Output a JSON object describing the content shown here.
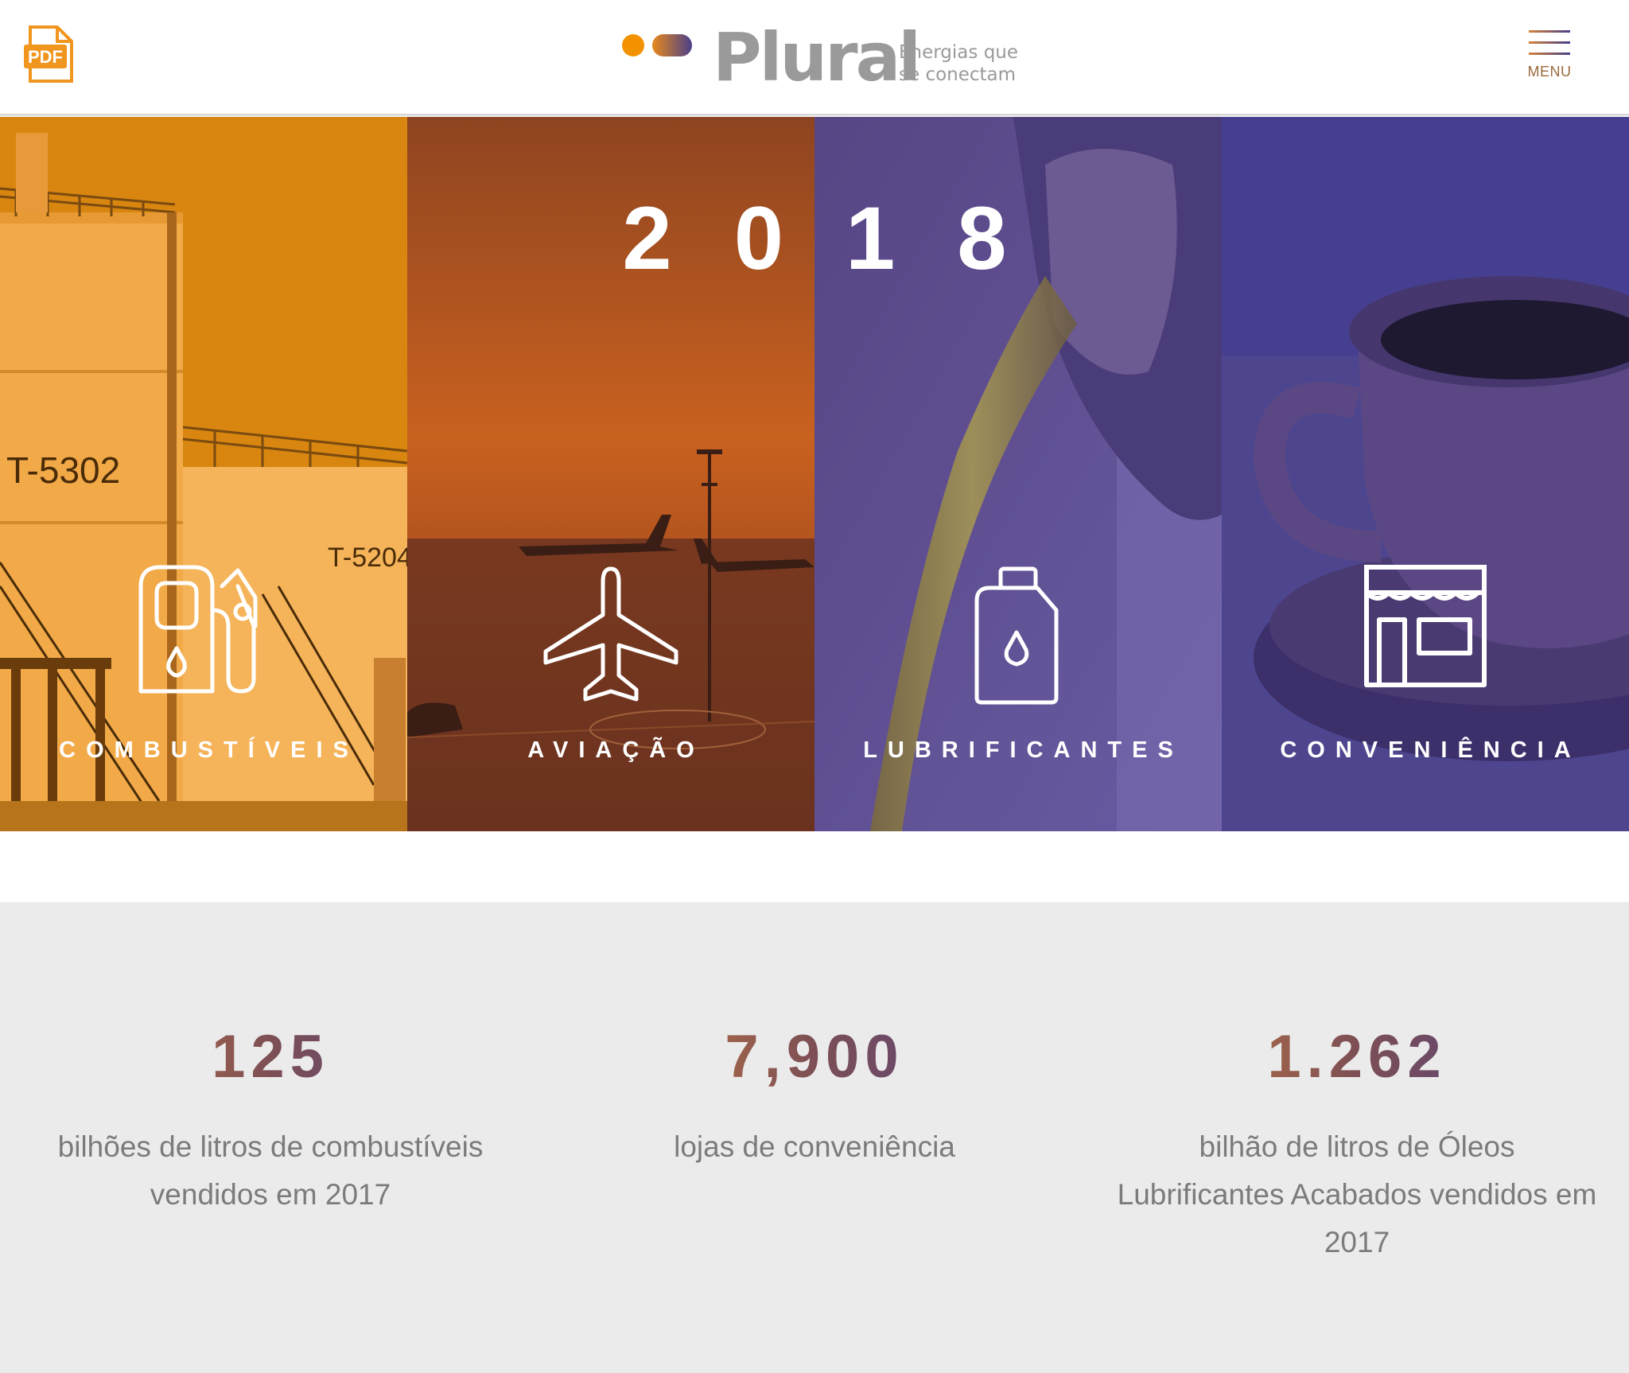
{
  "header": {
    "pdf_label": "PDF",
    "logo_word": "Plural",
    "logo_tagline_line1": "Energias que",
    "logo_tagline_line2": "se conectam",
    "menu_label": "MENU"
  },
  "hero": {
    "year": "2018",
    "panels": [
      {
        "label": "COMBUSTÍVEIS",
        "icon": "fuel-pump-icon",
        "tank_label_1": "T-5302",
        "tank_label_2": "T-5204",
        "color": "#d8860f"
      },
      {
        "label": "AVIAÇÃO",
        "icon": "airplane-icon",
        "color": "#b4541c"
      },
      {
        "label": "LUBRIFICANTES",
        "icon": "oil-bottle-icon",
        "color": "#5a4b96"
      },
      {
        "label": "CONVENIÊNCIA",
        "icon": "store-icon",
        "color": "#463f91"
      }
    ]
  },
  "stats": [
    {
      "number": "125",
      "line1": "bilhões de litros de combustíveis",
      "line2": "vendidos em 2017",
      "line3": ""
    },
    {
      "number": "7,900",
      "line1": "lojas de conveniência",
      "line2": "",
      "line3": ""
    },
    {
      "number": "1.262",
      "line1": "bilhão de litros de Óleos",
      "line2": "Lubrificantes Acabados vendidos em",
      "line3": "2017"
    }
  ],
  "colors": {
    "brand_orange": "#f39200",
    "brand_purple": "#4a3f8a",
    "gradient_start": "#d4823a",
    "gradient_end": "#4a3f8a",
    "stats_bg": "#ebebeb",
    "text_gray": "#7b7b7b"
  }
}
